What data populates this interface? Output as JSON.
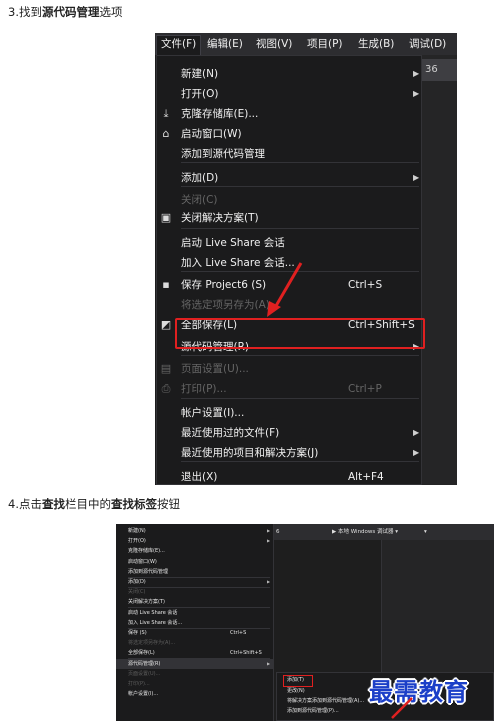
{
  "step3": {
    "prefix": "3.找到",
    "bold": "源代码管理",
    "suffix": "选项"
  },
  "step4": {
    "prefix": "4.点击",
    "bold1": "查找",
    "mid1": "栏目中的",
    "bold2": "查找标签",
    "suffix": "按钮"
  },
  "shot1": {
    "menubar": [
      "文件(F)",
      "编辑(E)",
      "视图(V)",
      "项目(P)",
      "生成(B)",
      "调试(D)"
    ],
    "side_tab": "36",
    "items": [
      {
        "label": "新建(N)",
        "icon": "",
        "shortcut": "",
        "submenu": true,
        "disabled": false
      },
      {
        "label": "打开(O)",
        "icon": "",
        "shortcut": "",
        "submenu": true,
        "disabled": false
      },
      {
        "label": "克隆存储库(E)...",
        "icon": "clone-icon",
        "shortcut": "",
        "submenu": false,
        "disabled": false
      },
      {
        "label": "启动窗口(W)",
        "icon": "start-window-icon",
        "shortcut": "",
        "submenu": false,
        "disabled": false
      },
      {
        "label": "添加到源代码管理",
        "icon": "",
        "shortcut": "",
        "submenu": false,
        "disabled": false
      },
      {
        "label": "添加(D)",
        "icon": "",
        "shortcut": "",
        "submenu": true,
        "disabled": false
      },
      {
        "label": "关闭(C)",
        "icon": "",
        "shortcut": "",
        "submenu": false,
        "disabled": true
      },
      {
        "label": "关闭解决方案(T)",
        "icon": "close-solution-icon",
        "shortcut": "",
        "submenu": false,
        "disabled": false
      },
      {
        "label": "启动 Live Share 会话",
        "icon": "",
        "shortcut": "",
        "submenu": false,
        "disabled": false
      },
      {
        "label": "加入 Live Share 会话...",
        "icon": "",
        "shortcut": "",
        "submenu": false,
        "disabled": false
      },
      {
        "label": "保存 Project6 (S)",
        "icon": "save-icon",
        "shortcut": "Ctrl+S",
        "submenu": false,
        "disabled": false
      },
      {
        "label": "将选定项另存为(A)...",
        "icon": "",
        "shortcut": "",
        "submenu": false,
        "disabled": true
      },
      {
        "label": "全部保存(L)",
        "icon": "save-all-icon",
        "shortcut": "Ctrl+Shift+S",
        "submenu": false,
        "disabled": false
      },
      {
        "label": "源代码管理(R)",
        "icon": "",
        "shortcut": "",
        "submenu": true,
        "disabled": false
      },
      {
        "label": "页面设置(U)...",
        "icon": "page-setup-icon",
        "shortcut": "",
        "submenu": false,
        "disabled": true
      },
      {
        "label": "打印(P)...",
        "icon": "print-icon",
        "shortcut": "Ctrl+P",
        "submenu": false,
        "disabled": true
      },
      {
        "label": "帐户设置(I)...",
        "icon": "",
        "shortcut": "",
        "submenu": false,
        "disabled": false
      },
      {
        "label": "最近使用过的文件(F)",
        "icon": "",
        "shortcut": "",
        "submenu": true,
        "disabled": false
      },
      {
        "label": "最近使用的项目和解决方案(J)",
        "icon": "",
        "shortcut": "",
        "submenu": true,
        "disabled": false
      },
      {
        "label": "退出(X)",
        "icon": "",
        "shortcut": "Alt+F4",
        "submenu": false,
        "disabled": false
      }
    ]
  },
  "shot2": {
    "toolbar": {
      "left": "6",
      "run_label": "▶ 本地 Windows 调试器 ▾",
      "extra": "▾"
    },
    "items": [
      {
        "label": "新建(N)",
        "shortcut": "",
        "submenu": true,
        "disabled": false
      },
      {
        "label": "打开(O)",
        "shortcut": "",
        "submenu": true,
        "disabled": false
      },
      {
        "label": "克隆存储库(E)...",
        "shortcut": "",
        "submenu": false,
        "disabled": false
      },
      {
        "label": "启动窗口(W)",
        "shortcut": "",
        "submenu": false,
        "disabled": false
      },
      {
        "label": "添加到源代码管理",
        "shortcut": "",
        "submenu": false,
        "disabled": false
      },
      {
        "label": "添加(D)",
        "shortcut": "",
        "submenu": true,
        "disabled": false
      },
      {
        "label": "关闭(C)",
        "shortcut": "",
        "submenu": false,
        "disabled": true
      },
      {
        "label": "关闭解决方案(T)",
        "shortcut": "",
        "submenu": false,
        "disabled": false
      },
      {
        "label": "启动 Live Share 会话",
        "shortcut": "",
        "submenu": false,
        "disabled": false
      },
      {
        "label": "加入 Live Share 会话...",
        "shortcut": "",
        "submenu": false,
        "disabled": false
      },
      {
        "label": "保存 (S)",
        "shortcut": "Ctrl+S",
        "submenu": false,
        "disabled": false
      },
      {
        "label": "将选定项另存为(A)...",
        "shortcut": "",
        "submenu": false,
        "disabled": true
      },
      {
        "label": "全部保存(L)",
        "shortcut": "Ctrl+Shift+S",
        "submenu": false,
        "disabled": false
      },
      {
        "label": "源代码管理(R)",
        "shortcut": "",
        "submenu": true,
        "disabled": false
      },
      {
        "label": "页面设置(U)...",
        "shortcut": "",
        "submenu": false,
        "disabled": true
      },
      {
        "label": "打印(P)...",
        "shortcut": "",
        "submenu": false,
        "disabled": true
      },
      {
        "label": "帐户设置(I)...",
        "shortcut": "",
        "submenu": false,
        "disabled": false
      }
    ],
    "submenu": [
      "添加(T)",
      "更改(N)",
      "将解决方案添加到源代码管理(A)...",
      "添加到源代码管理(P)..."
    ],
    "watermark": "最需教育"
  },
  "colors": {
    "highlight": "#e02020",
    "watermark": "#1b3fc8",
    "menu_bg": "#1b1b1c"
  }
}
